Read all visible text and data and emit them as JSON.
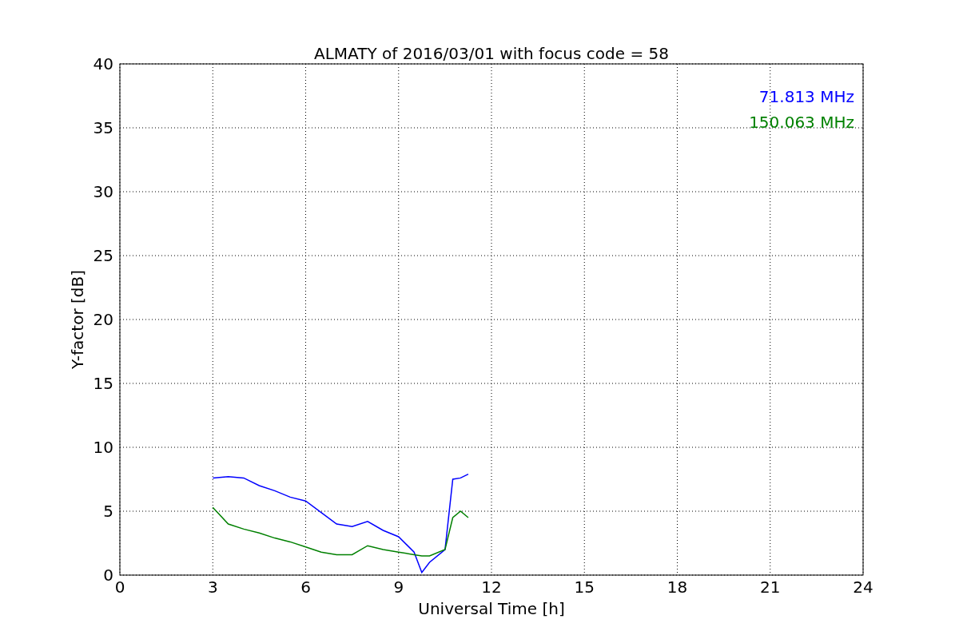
{
  "chart_data": {
    "type": "line",
    "title": "ALMATY of 2016/03/01 with focus code = 58",
    "xlabel": "Universal Time [h]",
    "ylabel": "Y-factor [dB]",
    "x": [
      3,
      3.5,
      4,
      4.5,
      5,
      5.5,
      6,
      6.5,
      7,
      7.5,
      8,
      8.5,
      9,
      9.5,
      9.75,
      10,
      10.5,
      10.75,
      11,
      11.25
    ],
    "series": [
      {
        "name": "71.813 MHz",
        "color": "#0000ff",
        "values": [
          7.6,
          7.7,
          7.6,
          7.0,
          6.6,
          6.1,
          5.8,
          4.9,
          4.0,
          3.8,
          4.2,
          3.5,
          3.0,
          1.8,
          0.2,
          1.0,
          2.0,
          7.5,
          7.6,
          7.9
        ]
      },
      {
        "name": "150.063 MHz",
        "color": "#008000",
        "values": [
          5.3,
          4.0,
          3.6,
          3.3,
          2.9,
          2.6,
          2.2,
          1.8,
          1.6,
          1.6,
          2.3,
          2.0,
          1.8,
          1.6,
          1.5,
          1.5,
          2.0,
          4.5,
          5.0,
          4.5
        ]
      }
    ],
    "grid": true,
    "xlim": [
      0,
      24
    ],
    "ylim": [
      0,
      40
    ],
    "xticks": [
      0,
      3,
      6,
      9,
      12,
      15,
      18,
      21,
      24
    ],
    "yticks": [
      0,
      5,
      10,
      15,
      20,
      25,
      30,
      35,
      40
    ]
  }
}
